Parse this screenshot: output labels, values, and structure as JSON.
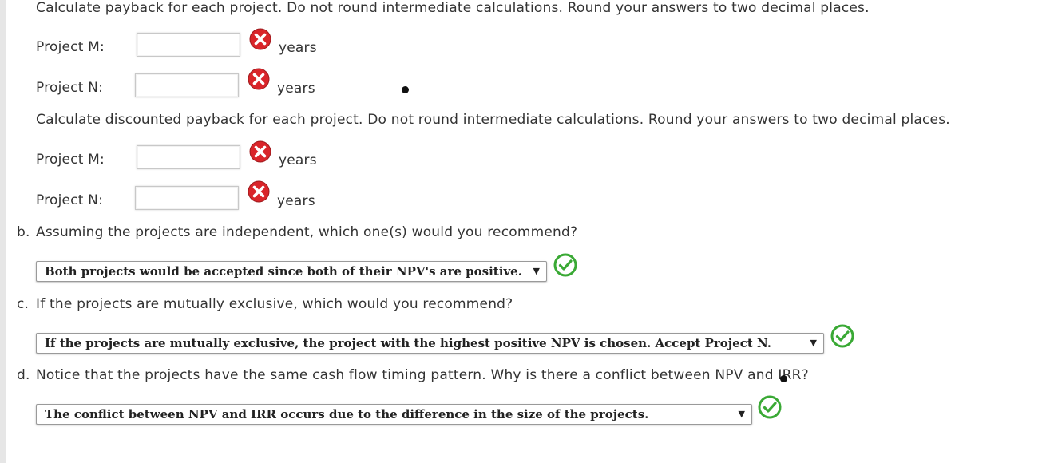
{
  "payback": {
    "instruction": "Calculate payback for each project. Do not round intermediate calculations. Round your answers to two decimal places.",
    "project_m_label": "Project M:",
    "project_n_label": "Project N:",
    "unit": "years",
    "project_m_value": "",
    "project_n_value": ""
  },
  "discounted_payback": {
    "instruction": "Calculate discounted payback for each project. Do not round intermediate calculations. Round your answers to two decimal places.",
    "project_m_label": "Project M:",
    "project_n_label": "Project N:",
    "unit": "years",
    "project_m_value": "",
    "project_n_value": ""
  },
  "question_b": {
    "letter": "b.",
    "text": "Assuming the projects are independent, which one(s) would you recommend?",
    "selected": "Both projects would be accepted since both of their NPV's are positive."
  },
  "question_c": {
    "letter": "c.",
    "text": "If the projects are mutually exclusive, which would you recommend?",
    "selected": "If the projects are mutually exclusive, the project with the highest positive NPV is chosen. Accept Project N."
  },
  "question_d": {
    "letter": "d.",
    "text": "Notice that the projects have the same cash flow timing pattern. Why is there a conflict between NPV and IRR?",
    "selected": "The conflict between NPV and IRR occurs due to the difference in the size of the projects."
  },
  "colors": {
    "incorrect": "#d9252a",
    "correct": "#3aa935",
    "text": "#333333"
  },
  "icons": {
    "incorrect": "x-circle-icon",
    "correct": "check-circle-icon",
    "dropdown": "triangle-down-icon"
  }
}
